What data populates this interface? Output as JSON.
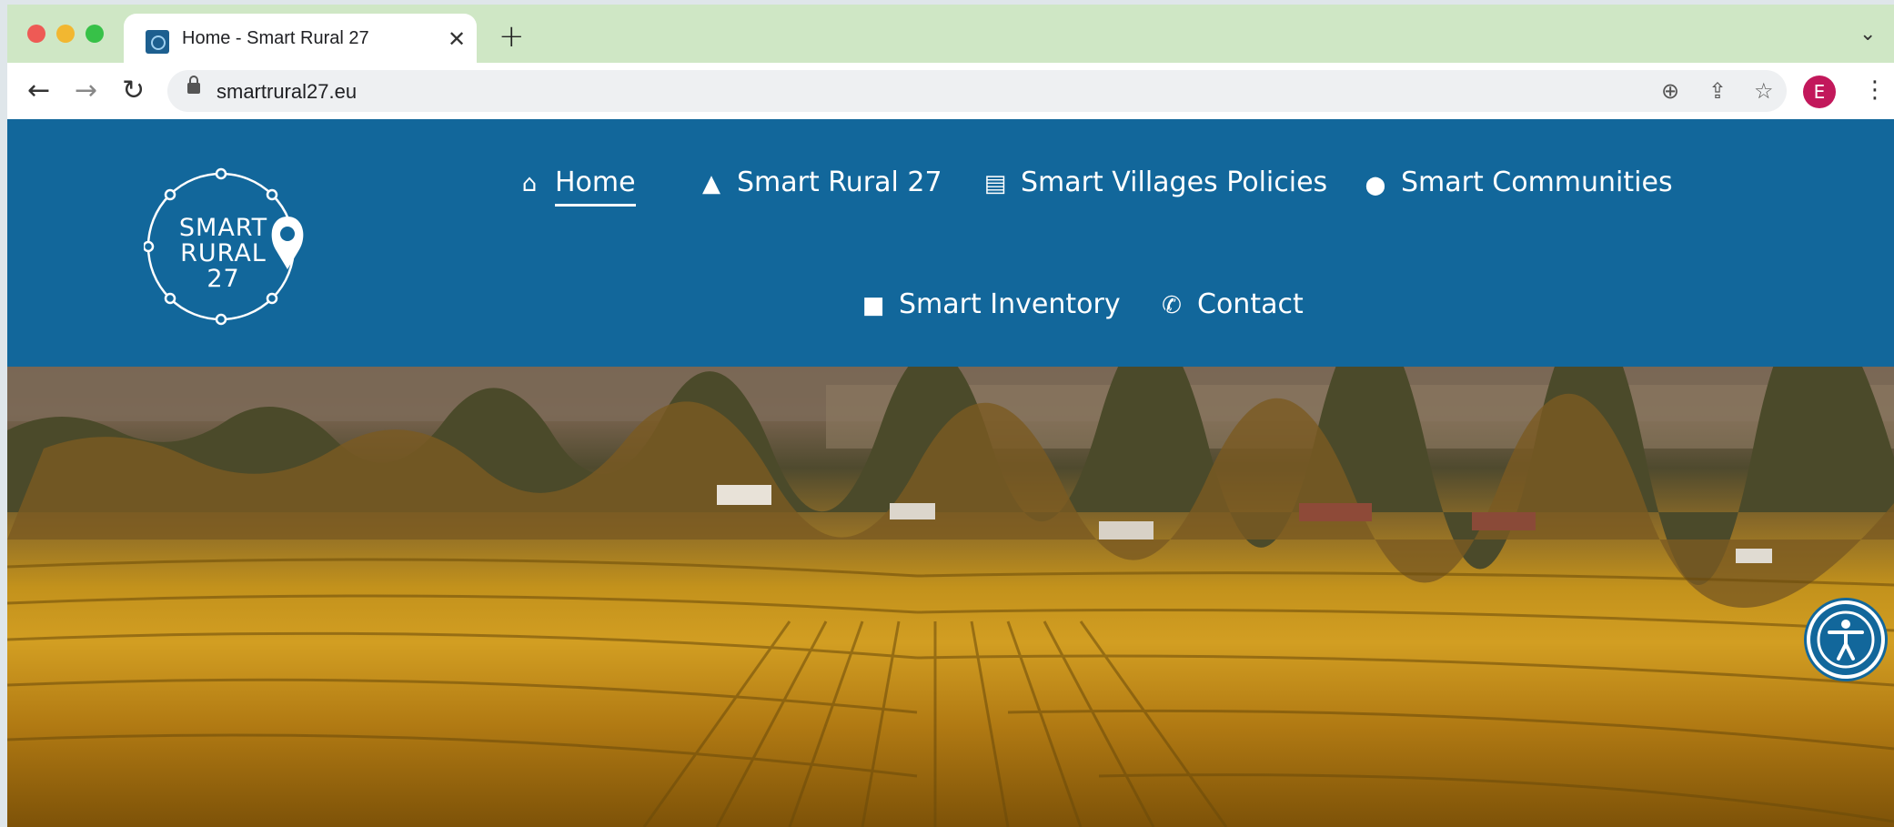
{
  "browser": {
    "tab": {
      "title": "Home - Smart Rural 27",
      "close_glyph": "✕"
    },
    "new_tab_glyph": "+",
    "tab_list_glyph": "⌄",
    "nav": {
      "back": "←",
      "forward": "→",
      "reload": "↻"
    },
    "url": "smartrural27.eu",
    "icons": {
      "zoom": "⊕",
      "share": "⇪",
      "star": "☆",
      "menu": "⋮"
    },
    "profile_initial": "E"
  },
  "site": {
    "logo_lines": [
      "SMART",
      "RURAL",
      "27"
    ],
    "nav": [
      {
        "label": "Home",
        "icon": "home-icon",
        "glyph": "⌂"
      },
      {
        "label": "Smart Rural 27",
        "icon": "tree-icon",
        "glyph": "▲"
      },
      {
        "label": "Smart Villages Policies",
        "icon": "document-icon",
        "glyph": "▤"
      },
      {
        "label": "Smart Communities",
        "icon": "map-marker-icon",
        "glyph": "⬤"
      },
      {
        "label": "Smart Inventory",
        "icon": "archive-icon",
        "glyph": "■"
      },
      {
        "label": "Contact",
        "icon": "phone-icon",
        "glyph": "✆"
      }
    ],
    "colors": {
      "header_bg": "#12679b",
      "text": "#ffffff"
    }
  }
}
